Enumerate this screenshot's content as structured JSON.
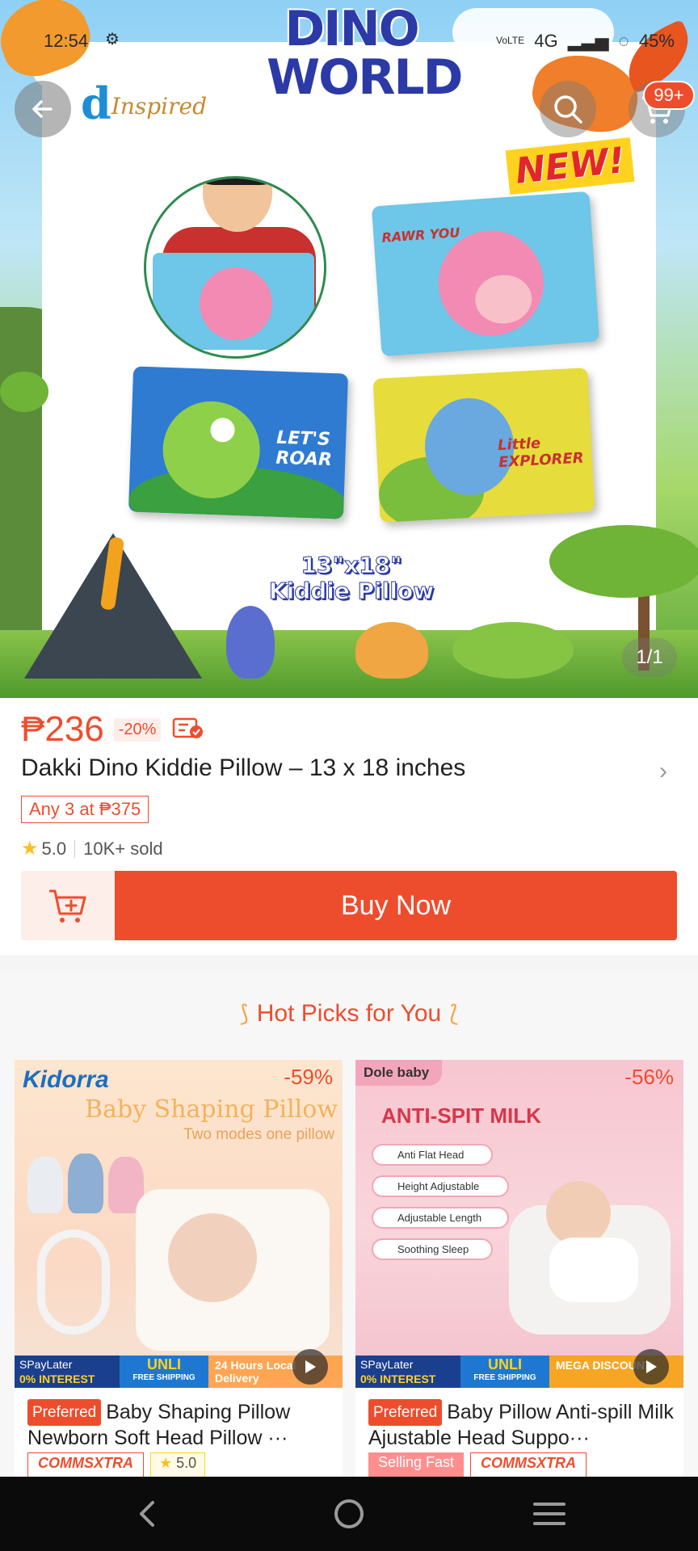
{
  "status_bar": {
    "time": "12:54",
    "volte": "VoLTE",
    "network": "4G",
    "battery": "45%"
  },
  "hero": {
    "banner_title": "DINO WORLD",
    "brand_logo_letter": "d",
    "brand_logo_text": "Inspired",
    "new_badge": "NEW!",
    "pillow_texts": [
      "RAWR YOU",
      "LET'S ROAR",
      "Little EXPLORER"
    ],
    "size_label_line1": "13\"x18\"",
    "size_label_line2": "Kiddie Pillow",
    "image_counter": "1/1"
  },
  "header": {
    "cart_count": "99+",
    "icons": [
      "back-arrow-icon",
      "search-icon",
      "cart-icon"
    ]
  },
  "product": {
    "price": "₱236",
    "discount": "-20%",
    "title": "Dakki Dino Kiddie Pillow  –  13 x 18 inches",
    "bundle_deal": "Any 3 at ₱375",
    "rating": "5.0",
    "sold": "10K+ sold",
    "buy_now_label": "Buy Now"
  },
  "hot_picks": {
    "section_title": "Hot Picks for You",
    "items": [
      {
        "brand": "Kidorra",
        "discount": "-59%",
        "image_headline": "Baby Shaping Pillow",
        "image_subline": "Two modes one pillow",
        "promo_spaylater": "SPayLater",
        "promo_interest": "0% INTEREST",
        "promo_unli": "UNLI",
        "promo_free_ship": "FREE SHIPPING",
        "promo_extra": "24 Hours Local Delivery",
        "preferred_label": "Preferred",
        "title": "Baby Shaping Pillow Newborn Soft Head Pillow ···",
        "badge_1": "COMMSXTRA",
        "badge_2": "5.0"
      },
      {
        "brand": "Dole baby",
        "discount": "-56%",
        "image_headline": "ANTI-SPIT MILK",
        "features": [
          "Anti Flat Head",
          "Height Adjustable",
          "Adjustable Length",
          "Soothing Sleep"
        ],
        "promo_spaylater": "SPayLater",
        "promo_interest": "0% INTEREST",
        "promo_unli": "UNLI",
        "promo_free_ship": "FREE SHIPPING",
        "promo_extra": "MEGA DISCOUNT",
        "preferred_label": "Preferred",
        "title": "Baby Pillow Anti-spill Milk Ajustable Head Suppo···",
        "badge_1": "Selling Fast",
        "badge_2": "COMMSXTRA"
      }
    ]
  },
  "colors": {
    "accent": "#ee4d2d",
    "accent_light": "#fdeeea",
    "star": "#ffbd20",
    "navbar": "#0b0b0b"
  },
  "nav_bar": {
    "icons": [
      "back-nav-icon",
      "home-nav-icon",
      "recents-nav-icon"
    ]
  }
}
